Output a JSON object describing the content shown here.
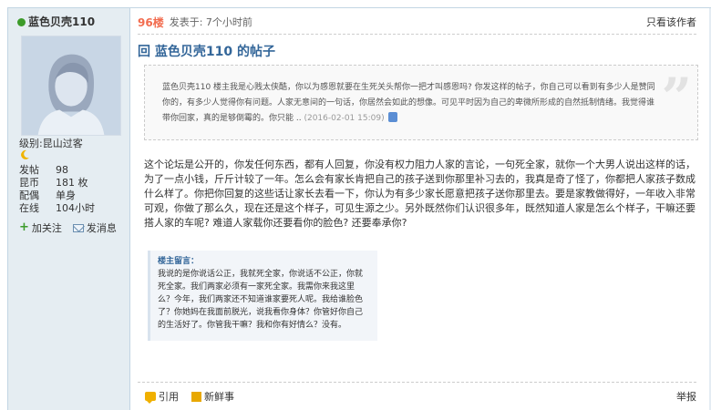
{
  "user": {
    "name": "蓝色贝壳110",
    "level_label": "级别:",
    "level_value": "昆山过客",
    "avatar_icon": "default-avatar-icon",
    "stats": [
      {
        "key": "发帖",
        "value": "98"
      },
      {
        "key": "昆币",
        "value": "181 枚"
      },
      {
        "key": "配偶",
        "value": "单身"
      },
      {
        "key": "在线",
        "value": "104小时"
      }
    ],
    "follow_label": "加关注",
    "message_label": "发消息"
  },
  "post": {
    "floor": "96楼",
    "posted_at": "发表于: 7个小时前",
    "only_author": "只看该作者",
    "title": "回 蓝色贝壳110 的帖子",
    "quote": {
      "text": "蓝色贝壳110 楼主我是心贱太侠酷，你以为感恩就要在生死关头帮你一把才叫感恩吗? 你发这样的帖子，你自己可以看到有多少人是赞同你的，有多少人觉得你有问题。人家无意间的一句话，你居然会如此的想像。可见平时因为自己的卑微所形成的自然抵制情绪。我觉得谁带你回家，真的是够倒霉的。你只能 ..",
      "time": "(2016-02-01 15:09)"
    },
    "body": "这个论坛是公开的，你发任何东西，都有人回复，你没有权力阻力人家的言论，一句死全家，就你一个大男人说出这样的话，为了一点小钱，斤斤计较了一年。怎么会有家长肯把自己的孩子送到你那里补习去的，我真是奇了怪了，你都把人家孩子数成什么样了。你把你回复的这些话让家长去看一下，你认为有多少家长愿意把孩子送你那里去。要是家教做得好，一年收入非常可观，你做了那么久，现在还是这个样子，可见生源之少。另外既然你们认识很多年，既然知道人家是怎么个样子，干嘛还要搭人家的车呢? 难道人家载你还要看你的脸色? 还要奉承你?",
    "note_title": "楼主留言：",
    "note_text": "我说的是你说话公正，我就死全家，你说话不公正，你就死全家。我们两家必须有一家死全家。我需你来我这里么？今年，我们两家还不知道谁家要死人呢。我给谁脸色了？你她妈在我面前脱光，说我看你身体？你管好你自己的生活好了。你管我干嘛？我和你有好情么？没有。",
    "reply_label": "引用",
    "edit_label": "新鲜事",
    "report_label": "举报"
  },
  "colors": {
    "sidebar_bg": "#e5edf2",
    "title_blue": "#336699",
    "floor_orange": "#f26c4f"
  }
}
